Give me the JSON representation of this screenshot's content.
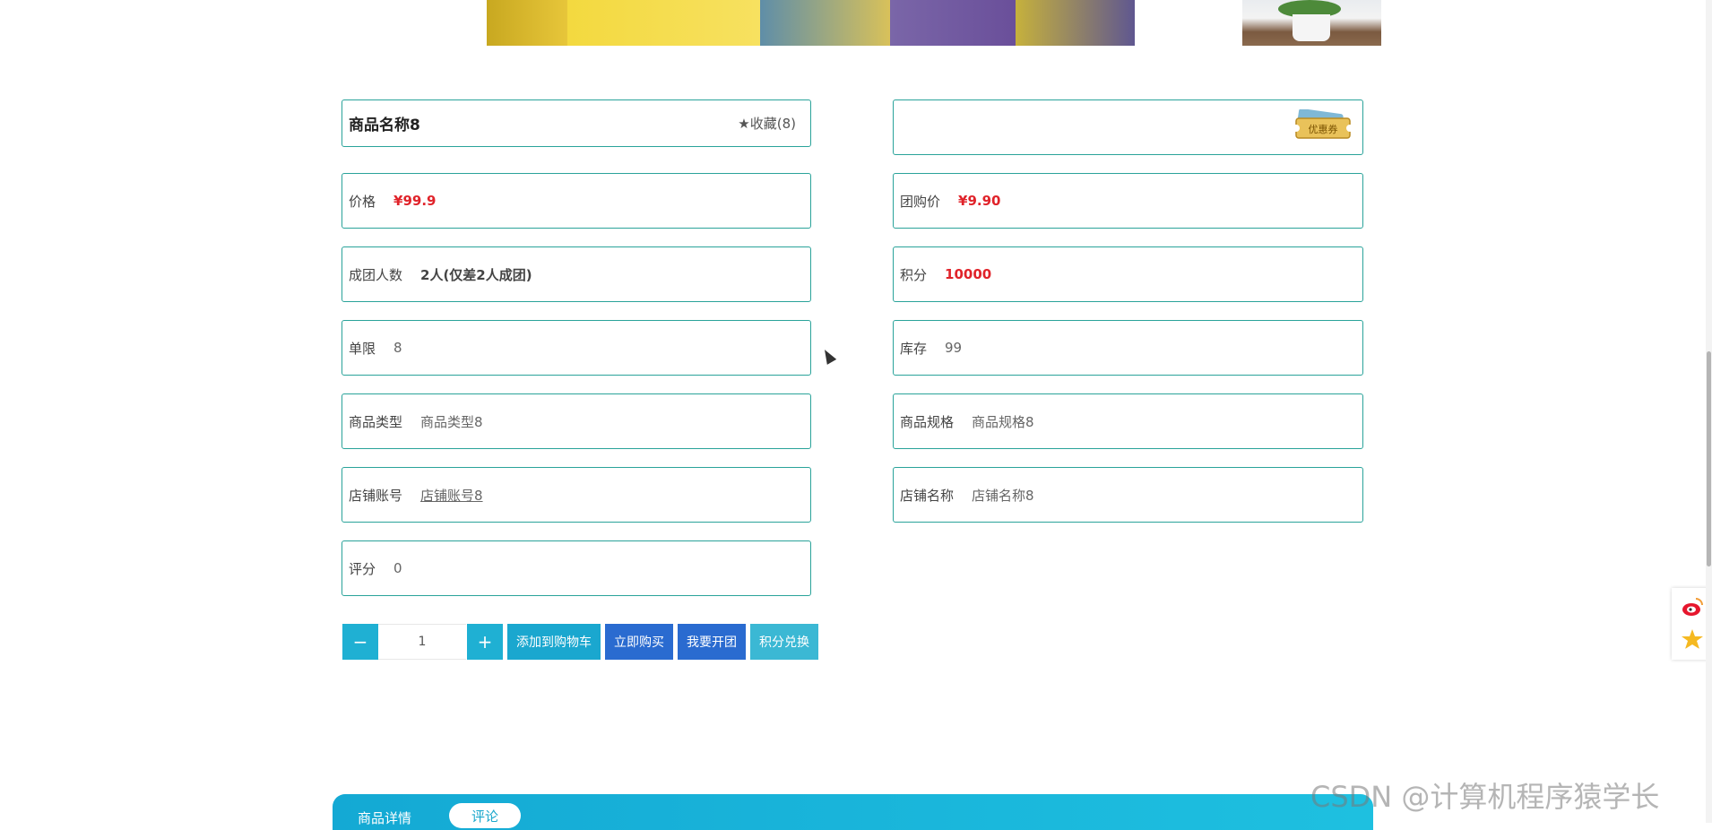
{
  "product": {
    "name": "商品名称8",
    "favorite_label": "收藏(8)"
  },
  "fields": {
    "price": {
      "label": "价格",
      "value": "¥99.9"
    },
    "group_price": {
      "label": "团购价",
      "value": "¥9.90"
    },
    "group_size": {
      "label": "成团人数",
      "value": "2人(仅差2人成团)"
    },
    "points": {
      "label": "积分",
      "value": "10000"
    },
    "limit": {
      "label": "单限",
      "value": "8"
    },
    "stock": {
      "label": "库存",
      "value": "99"
    },
    "type": {
      "label": "商品类型",
      "value": "商品类型8"
    },
    "spec": {
      "label": "商品规格",
      "value": "商品规格8"
    },
    "shop_account": {
      "label": "店铺账号",
      "value": "店铺账号8"
    },
    "shop_name": {
      "label": "店铺名称",
      "value": "店铺名称8"
    },
    "rating": {
      "label": "评分",
      "value": "0"
    }
  },
  "coupon_label": "优惠券",
  "actions": {
    "minus": "−",
    "quantity": "1",
    "plus": "+",
    "add_cart": "添加到购物车",
    "buy_now": "立即购买",
    "open_group": "我要开团",
    "exchange": "积分兑换"
  },
  "tabs": {
    "details": "商品详情",
    "comments": "评论"
  },
  "watermark": "CSDN @计算机程序猿学长",
  "colors": {
    "accent": "#1fb0d3",
    "primary_blue": "#2a6bd0",
    "border": "#2aa39a",
    "price_red": "#e0232a"
  }
}
